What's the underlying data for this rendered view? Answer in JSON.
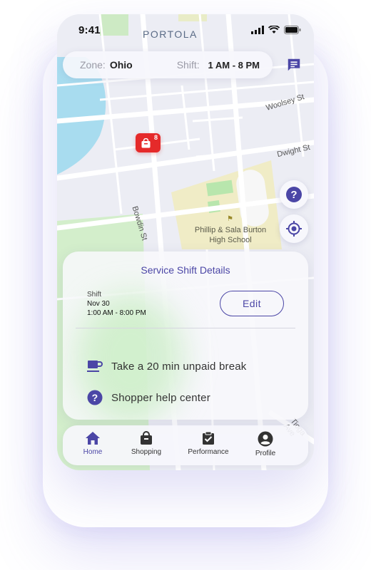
{
  "status": {
    "time": "9:41"
  },
  "map": {
    "neighborhood": "PORTOLA",
    "streets": [
      "Woolsey St",
      "Dwight St",
      "Bowdin St",
      "Tioga Ave"
    ],
    "school": "Phillip & Sala Burton High School",
    "store_count": "8"
  },
  "zone_bar": {
    "zone_label": "Zone:",
    "zone_value": "Ohio",
    "shift_label": "Shift:",
    "shift_value": "1 AM - 8 PM"
  },
  "sheet": {
    "title": "Service Shift Details",
    "shift_label": "Shift",
    "shift_date": "Nov 30",
    "shift_time": "1:00 AM - 8:00 PM",
    "edit_label": "Edit",
    "break_label": "Take a 20 min unpaid break",
    "help_label": "Shopper help center"
  },
  "tabs": [
    {
      "label": "Home",
      "icon": "home-icon",
      "active": true
    },
    {
      "label": "Shopping",
      "icon": "shopping-bag-icon",
      "active": false
    },
    {
      "label": "Performance",
      "icon": "clipboard-check-icon",
      "active": false
    },
    {
      "label": "Profile",
      "icon": "account-circle-icon",
      "active": false
    }
  ],
  "colors": {
    "accent": "#4b46a6",
    "pin": "#e52a2a",
    "water": "#a8dcef",
    "park": "#c7ecc0"
  }
}
